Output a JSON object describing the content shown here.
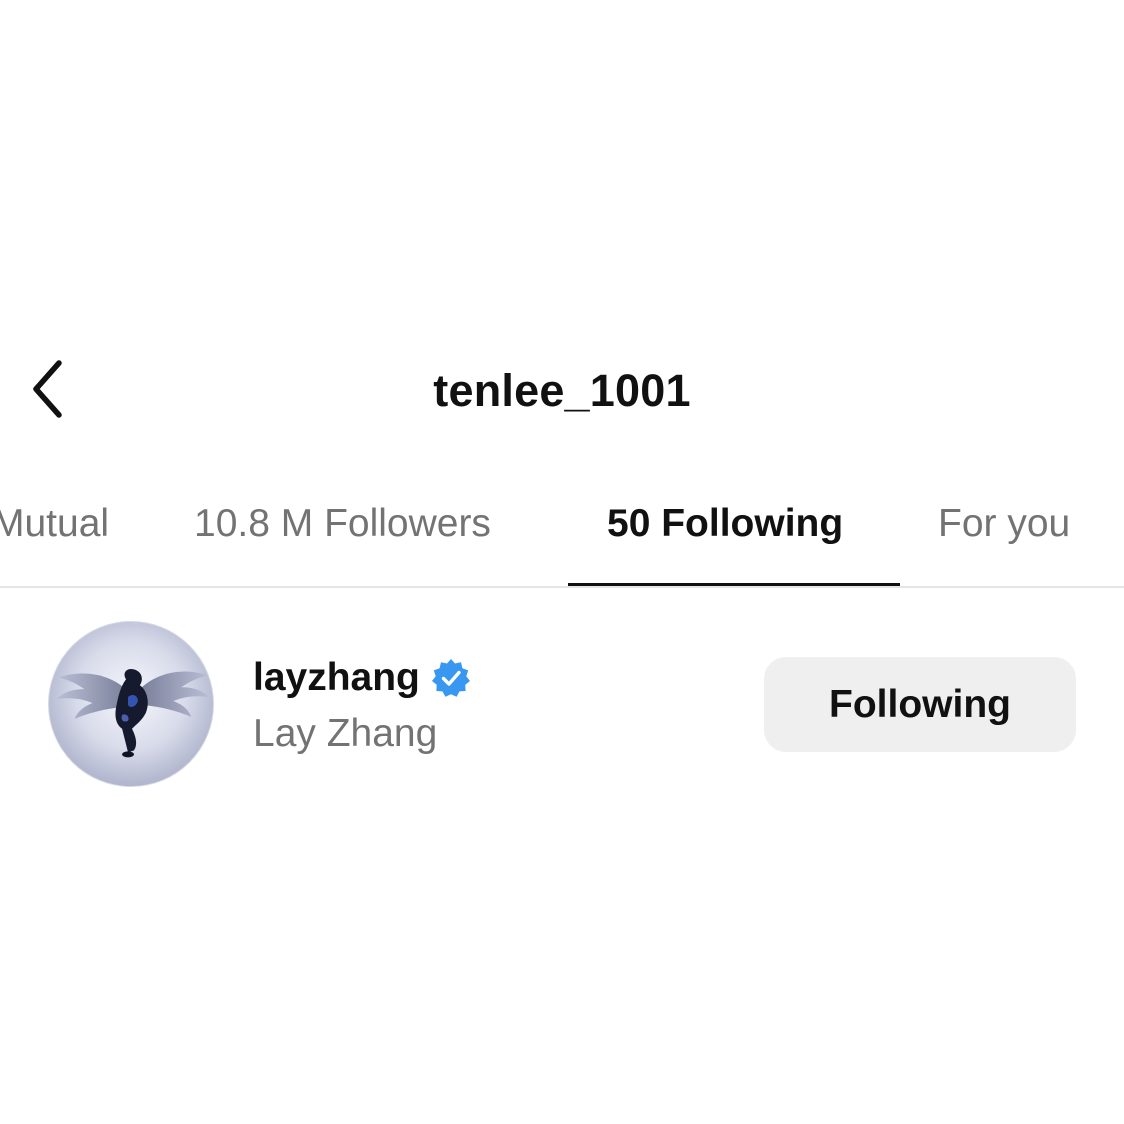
{
  "header": {
    "title": "tenlee_1001",
    "back_icon": "chevron-left-icon"
  },
  "tabs": [
    {
      "label": "Mutual",
      "active": false
    },
    {
      "label": "10.8 M Followers",
      "active": false
    },
    {
      "label": "50 Following",
      "active": true
    },
    {
      "label": "For you",
      "active": false
    }
  ],
  "list": {
    "items": [
      {
        "username": "layzhang",
        "verified": true,
        "verified_icon": "verified-badge-icon",
        "verified_color": "#3897f0",
        "full_name": "Lay Zhang",
        "avatar_icon": "winged-figure-avatar",
        "button_label": "Following"
      }
    ]
  },
  "colors": {
    "primary_text": "#111111",
    "secondary_text": "#737373",
    "button_bg": "#efefef",
    "divider": "#e5e5e5"
  }
}
